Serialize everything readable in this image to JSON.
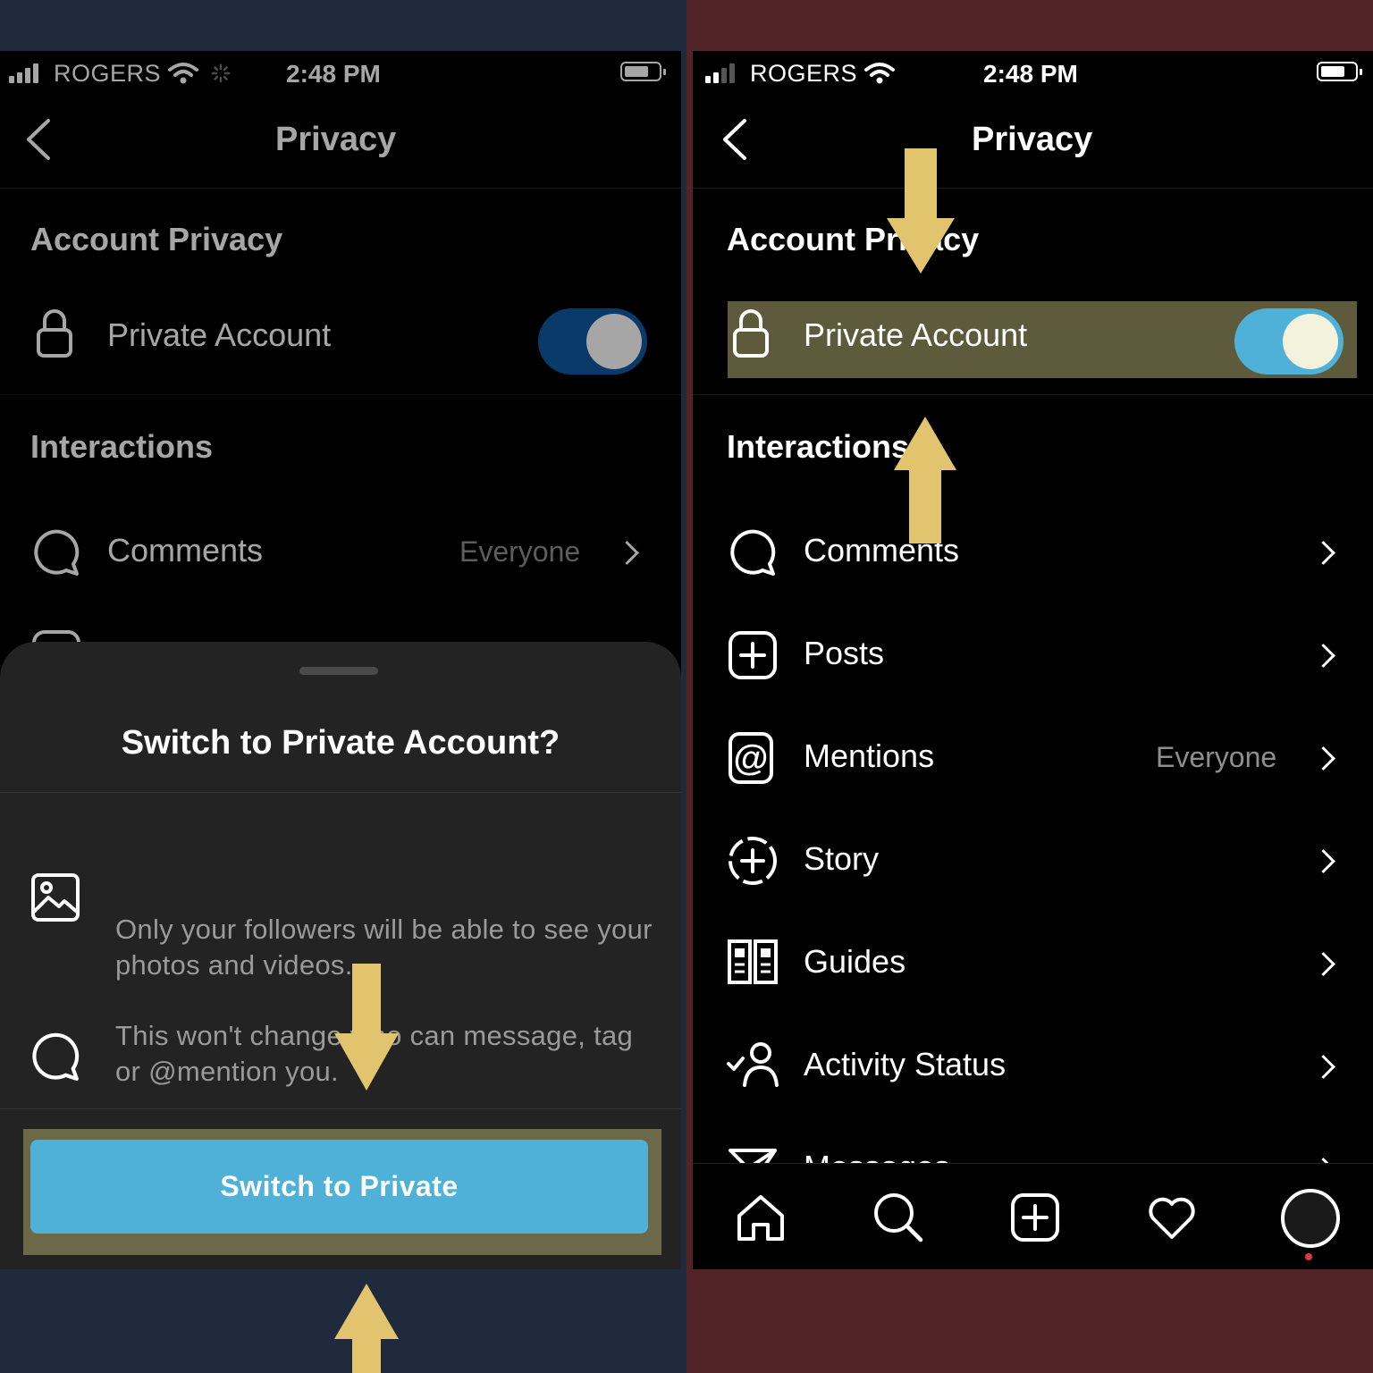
{
  "colors": {
    "left_background": "#1f2b3d",
    "right_background": "#532427",
    "arrow": "#e2c46e",
    "highlight": "#5d5b3b",
    "toggle_on_left": "#0f5aa1",
    "toggle_on_right": "#4fb1d8",
    "button": "#4fb1d8"
  },
  "left": {
    "status": {
      "carrier": "ROGERS",
      "time": "2:48 PM"
    },
    "nav": {
      "title": "Privacy",
      "back_icon": "chevron-left-icon"
    },
    "account_privacy": {
      "header": "Account Privacy",
      "private_account": {
        "label": "Private Account",
        "icon": "lock-icon",
        "toggle_on": true
      }
    },
    "interactions": {
      "header": "Interactions",
      "comments": {
        "label": "Comments",
        "value": "Everyone",
        "icon": "comment-icon"
      }
    },
    "sheet": {
      "title": "Switch to Private Account?",
      "item1": {
        "icon": "photo-icon",
        "text": "Only your followers will be able to see your photos and videos."
      },
      "item2": {
        "icon": "comment-icon",
        "text": "This won't change who can message, tag or @mention you."
      },
      "button": "Switch to Private"
    }
  },
  "right": {
    "status": {
      "carrier": "ROGERS",
      "time": "2:48 PM"
    },
    "nav": {
      "title": "Privacy",
      "back_icon": "chevron-left-icon"
    },
    "account_privacy": {
      "header": "Account Privacy",
      "private_account": {
        "label": "Private Account",
        "icon": "lock-icon",
        "toggle_on": true
      }
    },
    "interactions": {
      "header": "Interactions",
      "items": [
        {
          "label": "Comments",
          "value": "",
          "icon": "comment-icon"
        },
        {
          "label": "Posts",
          "value": "",
          "icon": "plus-square-icon"
        },
        {
          "label": "Mentions",
          "value": "Everyone",
          "icon": "at-icon"
        },
        {
          "label": "Story",
          "value": "",
          "icon": "story-plus-icon"
        },
        {
          "label": "Guides",
          "value": "",
          "icon": "guides-icon"
        },
        {
          "label": "Activity Status",
          "value": "",
          "icon": "activity-status-icon"
        },
        {
          "label": "Messages",
          "value": "",
          "icon": "messages-icon"
        }
      ]
    },
    "tabbar": [
      "home-icon",
      "search-icon",
      "new-post-icon",
      "heart-icon",
      "profile-avatar"
    ]
  }
}
